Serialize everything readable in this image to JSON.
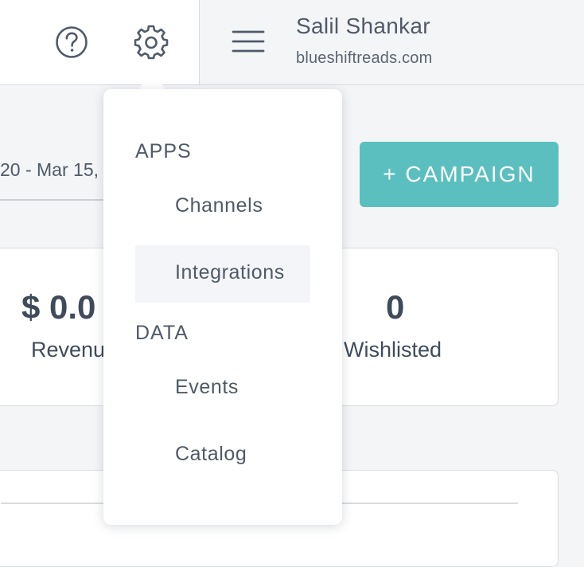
{
  "header": {
    "help_icon": "question-circle-icon",
    "settings_icon": "gear-icon",
    "menu_icon": "hamburger-menu-icon",
    "user_name": "Salil Shankar",
    "user_domain": "blueshiftreads.com"
  },
  "toolbar": {
    "date_range": "20 - Mar 15,",
    "campaign_button_label": "+ CAMPAIGN",
    "accent_color": "#5bbfbf"
  },
  "stats": [
    {
      "value": "$ 0.0",
      "label": "Revenu"
    },
    {
      "value": "0",
      "label": "Wishlisted"
    }
  ],
  "settings_menu": {
    "sections": [
      {
        "title": "APPS",
        "items": [
          {
            "label": "Channels"
          },
          {
            "label": "Integrations",
            "highlighted": true
          }
        ]
      },
      {
        "title": "DATA",
        "items": [
          {
            "label": "Events"
          },
          {
            "label": "Catalog"
          }
        ]
      }
    ]
  }
}
